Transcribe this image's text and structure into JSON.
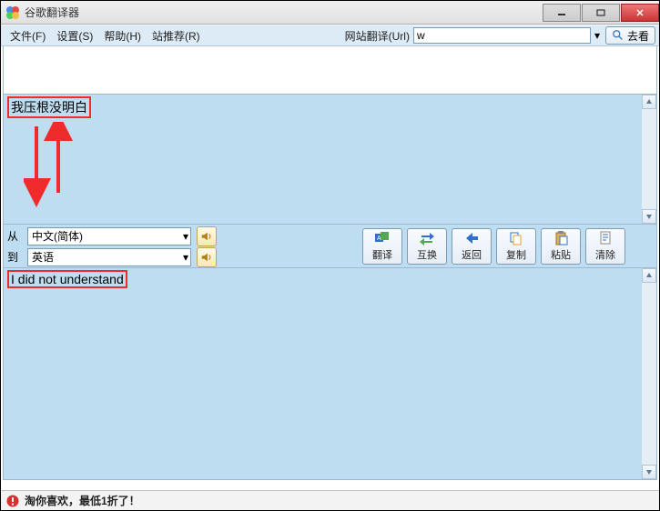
{
  "titlebar": {
    "title": "谷歌翻译器"
  },
  "menubar": {
    "file": "文件(F)",
    "settings": "设置(S)",
    "help": "帮助(H)",
    "recommend": "站推荐(R)",
    "url_label": "网站翻译(Url)",
    "url_value": "w",
    "go_label": "去看"
  },
  "input": {
    "source_text": "我压根没明白"
  },
  "lang": {
    "from_label": "从",
    "to_label": "到",
    "from_value": "中文(简体)",
    "to_value": "英语"
  },
  "toolbar": {
    "translate": "翻译",
    "swap": "互换",
    "back": "返回",
    "copy": "复制",
    "paste": "粘贴",
    "clear": "清除"
  },
  "output": {
    "translated_text": "I did not understand"
  },
  "statusbar": {
    "message": "淘你喜欢，最低1折了！"
  }
}
